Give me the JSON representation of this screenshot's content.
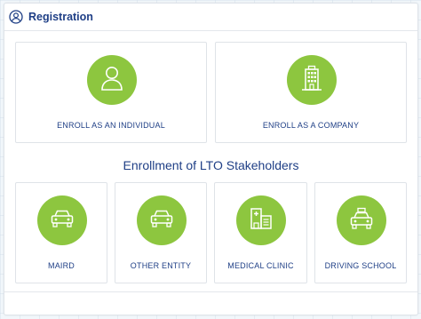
{
  "header": {
    "title": "Registration",
    "icon": "user-circle-icon"
  },
  "top_cards": [
    {
      "label": "ENROLL AS AN INDIVIDUAL",
      "icon": "person-icon"
    },
    {
      "label": "ENROLL AS A COMPANY",
      "icon": "building-icon"
    }
  ],
  "section": {
    "title": "Enrollment of LTO Stakeholders"
  },
  "bottom_cards": [
    {
      "label": "MAIRD",
      "icon": "car-icon"
    },
    {
      "label": "OTHER ENTITY",
      "icon": "car-icon"
    },
    {
      "label": "MEDICAL CLINIC",
      "icon": "hospital-icon"
    },
    {
      "label": "DRIVING SCHOOL",
      "icon": "taxi-icon"
    }
  ],
  "colors": {
    "accent_green": "#8dc63f",
    "text_blue": "#1f3f86"
  }
}
